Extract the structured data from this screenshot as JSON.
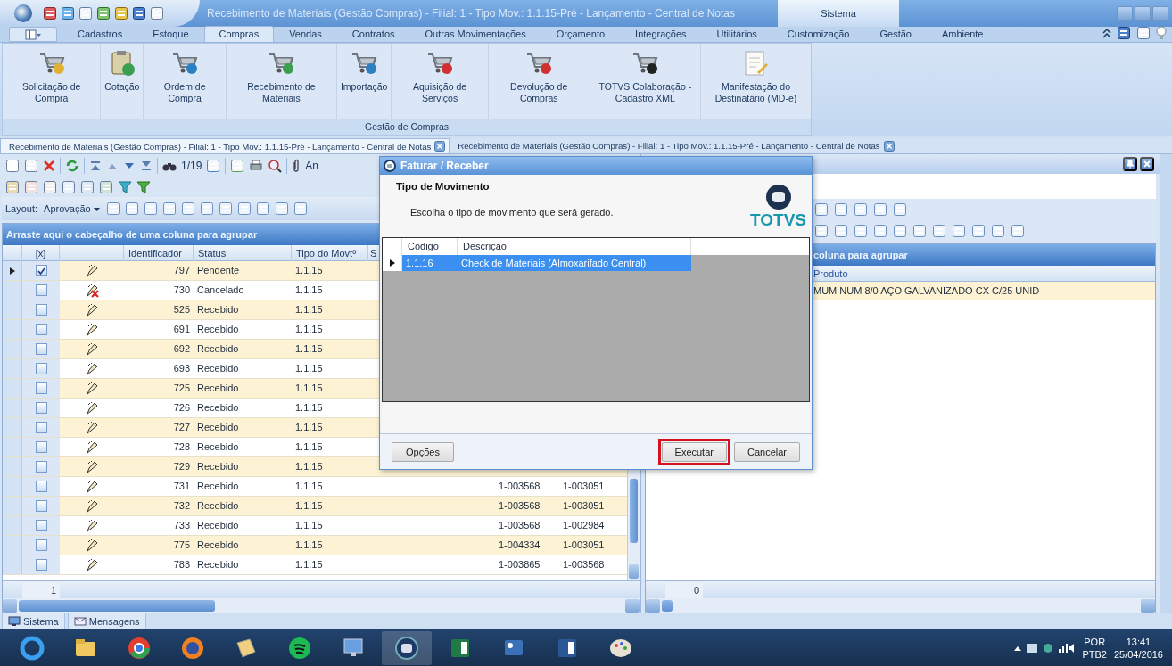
{
  "window": {
    "title": "Recebimento de Materiais (Gestão Compras) - Filial: 1 - Tipo Mov.: 1.1.15-Pré - Lançamento - Central de Notas",
    "context_tab": "Sistema"
  },
  "menu_tabs": [
    {
      "label": "Cadastros",
      "selected": false
    },
    {
      "label": "Estoque",
      "selected": false
    },
    {
      "label": "Compras",
      "selected": true
    },
    {
      "label": "Vendas",
      "selected": false
    },
    {
      "label": "Contratos",
      "selected": false
    },
    {
      "label": "Outras Movimentações",
      "selected": false
    },
    {
      "label": "Orçamento",
      "selected": false
    },
    {
      "label": "Integrações",
      "selected": false
    },
    {
      "label": "Utilitários",
      "selected": false
    },
    {
      "label": "Customização",
      "selected": false
    },
    {
      "label": "Gestão",
      "selected": false
    },
    {
      "label": "Ambiente",
      "selected": false
    }
  ],
  "ribbon": {
    "buttons": [
      {
        "label": "Solicitação de Compra",
        "kind": "cart"
      },
      {
        "label": "Cotação",
        "kind": "clipboard"
      },
      {
        "label": "Ordem de Compra",
        "kind": "cart"
      },
      {
        "label": "Recebimento de Materiais",
        "kind": "cart"
      },
      {
        "label": "Importação",
        "kind": "cart"
      },
      {
        "label": "Aquisição de Serviços",
        "kind": "cart"
      },
      {
        "label": "Devolução de Compras",
        "kind": "cart"
      },
      {
        "label": "TOTVS Colaboração - Cadastro XML",
        "kind": "cart"
      },
      {
        "label": "Manifestação do Destinatário (MD-e)",
        "kind": "notepad"
      }
    ],
    "group_label": "Gestão de Compras"
  },
  "document_tabs": [
    {
      "label": "Recebimento de Materiais (Gestão Compras) - Filial: 1 - Tipo Mov.: 1.1.15-Pré - Lançamento - Central de Notas",
      "selected": true
    },
    {
      "label": "Recebimento de Materiais (Gestão Compras) - Filial: 1 - Tipo Mov.: 1.1.15-Pré - Lançamento - Central de Notas",
      "selected": false
    }
  ],
  "left_panel": {
    "page": "1/19",
    "attach_label": "An",
    "layout_label": "Layout:",
    "layout_value": "Aprovação",
    "group_prompt": "Arraste aqui o cabeçalho de uma coluna para agrupar",
    "columns": [
      "[x]",
      "Identificador",
      "Status",
      "Tipo do Movtº",
      "S"
    ],
    "rows": [
      {
        "id": "797",
        "status": "Pendente",
        "type": "1.1.15",
        "checked": true,
        "selected": true,
        "cancelled": false
      },
      {
        "id": "730",
        "status": "Cancelado",
        "type": "1.1.15",
        "checked": false,
        "selected": false,
        "cancelled": true
      },
      {
        "id": "525",
        "status": "Recebido",
        "type": "1.1.15",
        "checked": false,
        "selected": false,
        "cancelled": false
      },
      {
        "id": "691",
        "status": "Recebido",
        "type": "1.1.15",
        "checked": false,
        "selected": false,
        "cancelled": false
      },
      {
        "id": "692",
        "status": "Recebido",
        "type": "1.1.15",
        "checked": false,
        "selected": false,
        "cancelled": false
      },
      {
        "id": "693",
        "status": "Recebido",
        "type": "1.1.15",
        "checked": false,
        "selected": false,
        "cancelled": false
      },
      {
        "id": "725",
        "status": "Recebido",
        "type": "1.1.15",
        "checked": false,
        "selected": false,
        "cancelled": false
      },
      {
        "id": "726",
        "status": "Recebido",
        "type": "1.1.15",
        "checked": false,
        "selected": false,
        "cancelled": false
      },
      {
        "id": "727",
        "status": "Recebido",
        "type": "1.1.15",
        "checked": false,
        "selected": false,
        "cancelled": false
      },
      {
        "id": "728",
        "status": "Recebido",
        "type": "1.1.15",
        "checked": false,
        "selected": false,
        "cancelled": false
      },
      {
        "id": "729",
        "status": "Recebido",
        "type": "1.1.15",
        "checked": false,
        "selected": false,
        "cancelled": false
      },
      {
        "id": "731",
        "status": "Recebido",
        "type": "1.1.15",
        "checked": false,
        "selected": false,
        "cancelled": false,
        "column_7": "1-003568",
        "column_8": "1-003051"
      },
      {
        "id": "732",
        "status": "Recebido",
        "type": "1.1.15",
        "checked": false,
        "selected": false,
        "cancelled": false,
        "column_7": "1-003568",
        "column_8": "1-003051"
      },
      {
        "id": "733",
        "status": "Recebido",
        "type": "1.1.15",
        "checked": false,
        "selected": false,
        "cancelled": false,
        "column_7": "1-003568",
        "column_8": "1-002984"
      },
      {
        "id": "775",
        "status": "Recebido",
        "type": "1.1.15",
        "checked": false,
        "selected": false,
        "cancelled": false,
        "column_7": "1-004334",
        "column_8": "1-003051"
      },
      {
        "id": "783",
        "status": "Recebido",
        "type": "1.1.15",
        "checked": false,
        "selected": false,
        "cancelled": false,
        "column_7": "1-003865",
        "column_8": "1-003568"
      }
    ],
    "footer_count": "1"
  },
  "right_panel": {
    "group_prompt": "coluna para agrupar",
    "column": "Produto",
    "rows": [
      "MUM NUM 8/0 AÇO GALVANIZADO CX C/25 UNID"
    ],
    "footer_count": "0"
  },
  "dialog": {
    "title": "Faturar / Receber",
    "heading": "Tipo de Movimento",
    "subtitle": "Escolha o tipo de movimento que será gerado.",
    "logo": "TOTVS",
    "columns": [
      "Código",
      "Descrição"
    ],
    "rows": [
      {
        "code": "1.1.16",
        "description": "Check de Materiais (Almoxarifado Central)",
        "selected": true
      }
    ],
    "buttons": [
      {
        "label": "Opções",
        "highlighted": false
      },
      {
        "label": "Executar",
        "highlighted": true
      },
      {
        "label": "Cancelar",
        "highlighted": false
      }
    ]
  },
  "status_tabs": [
    {
      "label": "Sistema"
    },
    {
      "label": "Mensagens"
    }
  ],
  "taskbar": {
    "language": "POR",
    "keyboard": "PTB2",
    "time": "13:41",
    "date": "25/04/2016"
  }
}
